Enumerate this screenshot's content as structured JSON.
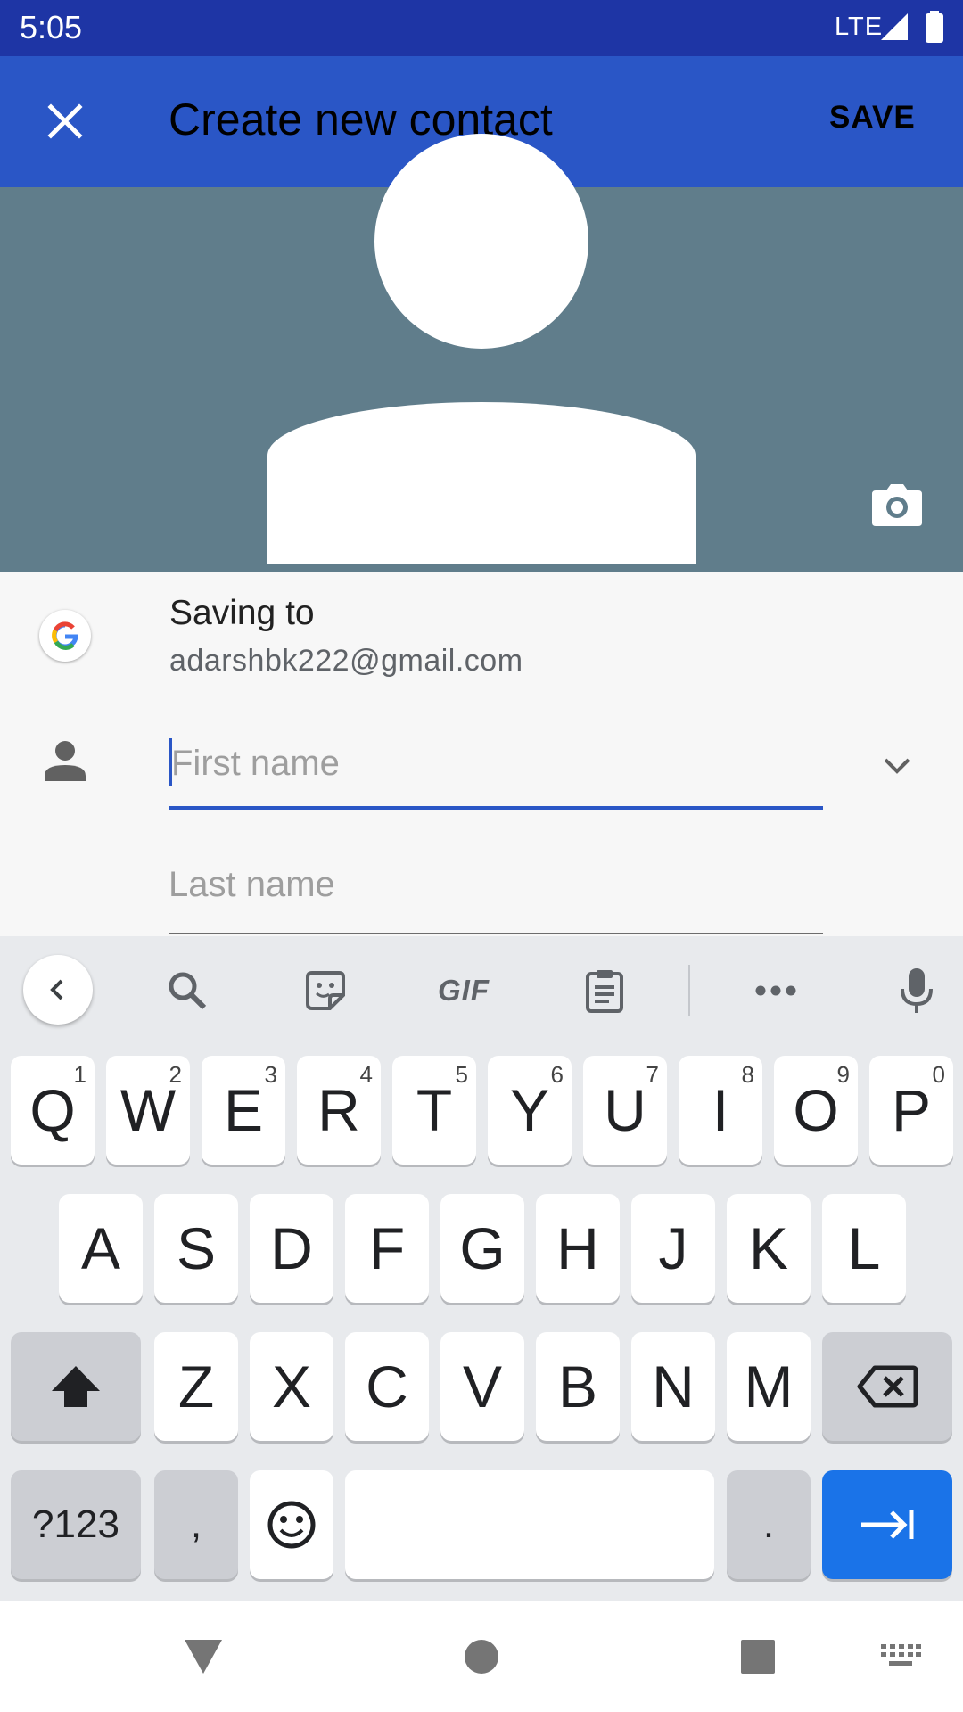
{
  "status_bar": {
    "time": "5:05",
    "network": "LTE"
  },
  "app_bar": {
    "title": "Create new contact",
    "save_label": "SAVE"
  },
  "account": {
    "label": "Saving to",
    "email": "adarshbk222@gmail.com"
  },
  "form": {
    "first_name": {
      "placeholder": "First name",
      "value": ""
    },
    "last_name": {
      "placeholder": "Last name",
      "value": ""
    }
  },
  "keyboard": {
    "toolbar": {
      "gif_label": "GIF"
    },
    "row1": [
      {
        "label": "Q",
        "hint": "1"
      },
      {
        "label": "W",
        "hint": "2"
      },
      {
        "label": "E",
        "hint": "3"
      },
      {
        "label": "R",
        "hint": "4"
      },
      {
        "label": "T",
        "hint": "5"
      },
      {
        "label": "Y",
        "hint": "6"
      },
      {
        "label": "U",
        "hint": "7"
      },
      {
        "label": "I",
        "hint": "8"
      },
      {
        "label": "O",
        "hint": "9"
      },
      {
        "label": "P",
        "hint": "0"
      }
    ],
    "row2": [
      "A",
      "S",
      "D",
      "F",
      "G",
      "H",
      "J",
      "K",
      "L"
    ],
    "row3": [
      "Z",
      "X",
      "C",
      "V",
      "B",
      "N",
      "M"
    ],
    "symbols_label": "?123",
    "comma_label": ",",
    "period_label": "."
  },
  "colors": {
    "status_bar": "#1e35a5",
    "app_bar": "#2a56c6",
    "photo_background": "#607d8b",
    "enter_key": "#1a73e8"
  },
  "icons": {
    "close": "close-icon",
    "camera": "camera-icon",
    "google": "google-logo",
    "person": "person-icon",
    "chevron": "chevron-down-icon",
    "search": "search-icon",
    "sticker": "sticker-icon",
    "clipboard": "clipboard-icon",
    "more": "more-horiz-icon",
    "mic": "mic-icon",
    "shift": "shift-icon",
    "backspace": "backspace-icon",
    "emoji": "emoji-icon",
    "enter": "tab-next-icon"
  }
}
